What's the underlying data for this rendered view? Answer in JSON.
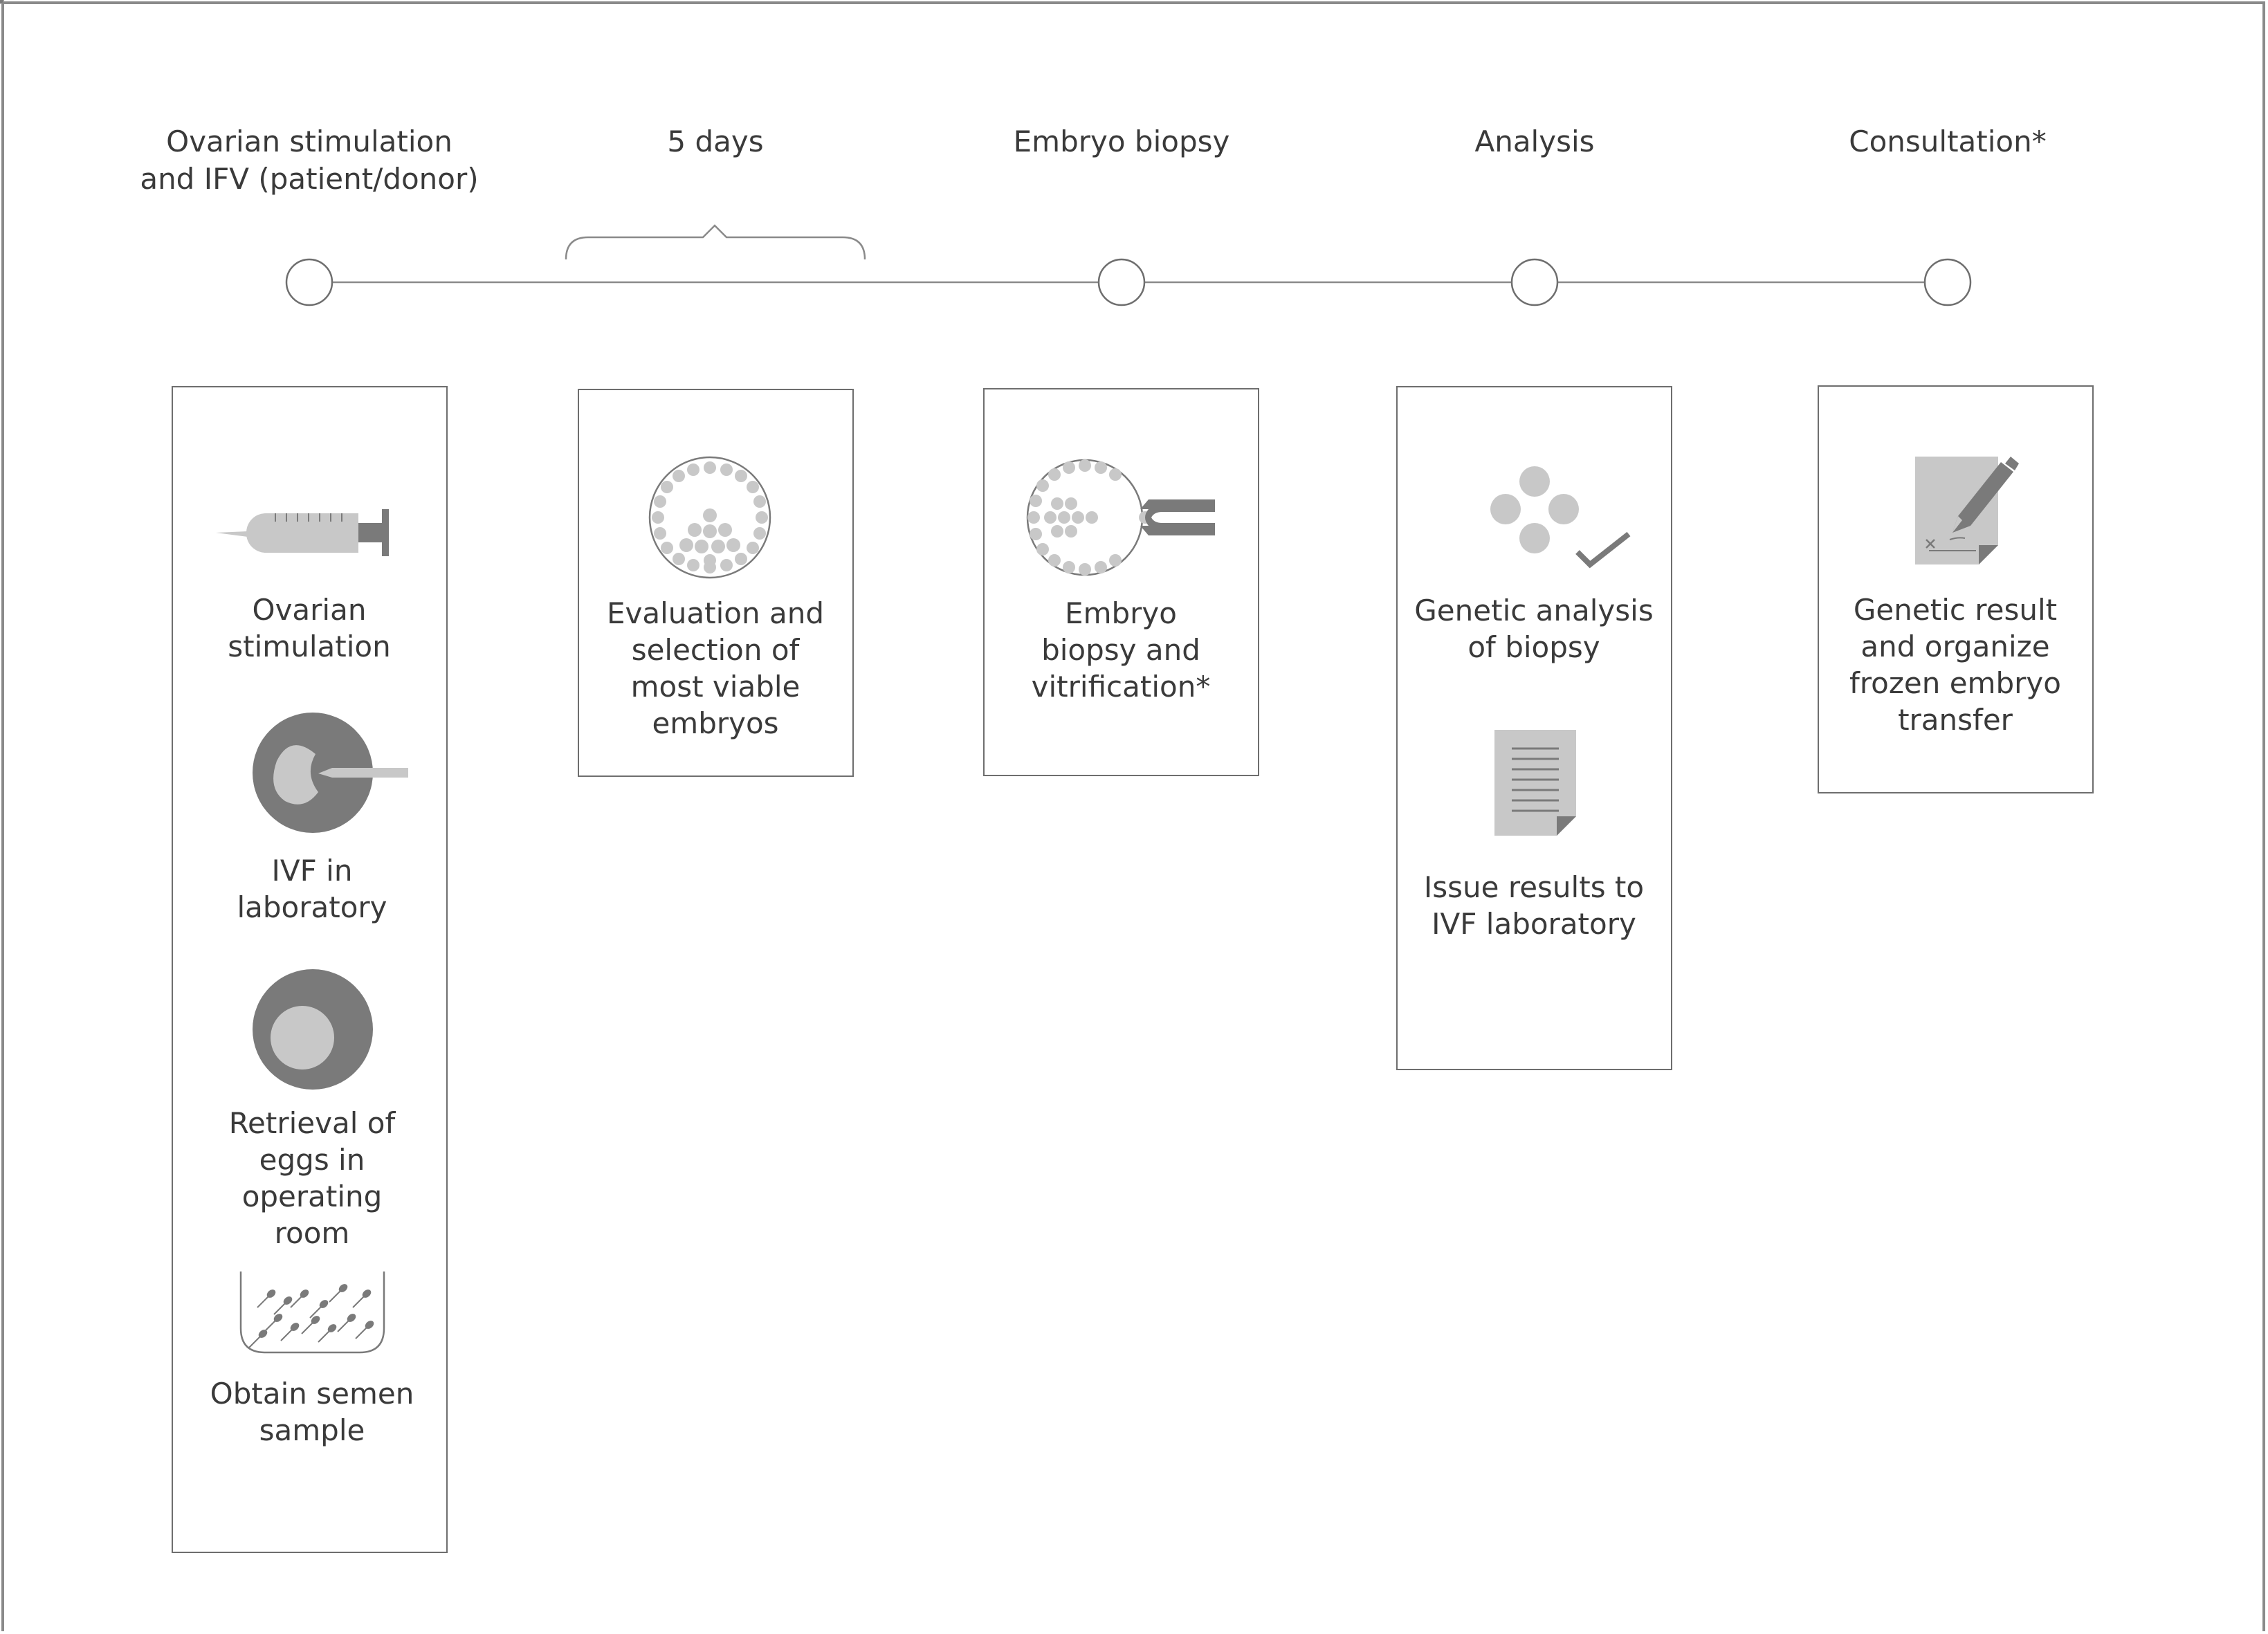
{
  "stages": [
    {
      "label": "Ovarian stimulation\nand IFV (patient/donor)"
    },
    {
      "label": "5 days"
    },
    {
      "label": "Embryo biopsy"
    },
    {
      "label": "Analysis"
    },
    {
      "label": "Consultation*"
    }
  ],
  "steps": {
    "ovarian_stimulation": "Ovarian\nstimulation",
    "ivf_laboratory": "IVF in\nlaboratory",
    "egg_retrieval": "Retrieval of\neggs in\noperating\nroom",
    "semen_sample": "Obtain semen\nsample",
    "embryo_selection": "Evaluation and\nselection of\nmost viable\nembryos",
    "embryo_biopsy": "Embryo\nbiopsy and\nvitrification*",
    "genetic_analysis": "Genetic analysis\nof biopsy",
    "issue_results": "Issue results to\nIVF laboratory",
    "genetic_result": "Genetic result\nand organize\nfrozen embryo\ntransfer"
  },
  "colors": {
    "dark_gray": "#7a7a7a",
    "light_gray": "#c8c8c8",
    "line": "#8a8a8a",
    "text": "#3a3a3a"
  },
  "icons": [
    "syringe-icon",
    "ivf-injection-icon",
    "egg-cell-icon",
    "sperm-dish-icon",
    "embryo-icon",
    "biopsy-pipette-icon",
    "genetic-cells-check-icon",
    "document-icon",
    "signed-document-icon"
  ]
}
